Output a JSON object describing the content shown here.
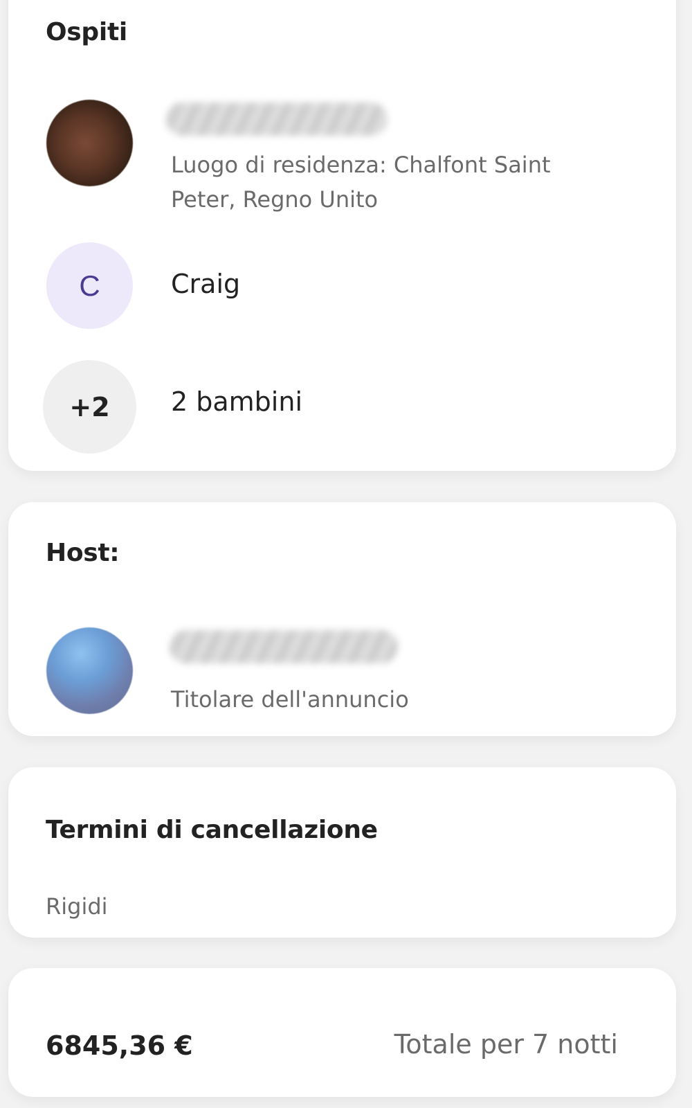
{
  "guests_section": {
    "title": "Ospiti",
    "guests": [
      {
        "avatar": "photo",
        "name_visible": false,
        "detail": "Luogo di residenza: Chalfont Saint Peter, Regno Unito"
      },
      {
        "avatar_letter": "C",
        "name": "Craig"
      },
      {
        "avatar_count": "+2",
        "name": "2 bambini"
      }
    ]
  },
  "host_section": {
    "title": "Host:",
    "host": {
      "avatar": "photo",
      "name_visible": false,
      "role": "Titolare dell'annuncio"
    }
  },
  "cancellation": {
    "title": "Termini di cancellazione",
    "value": "Rigidi"
  },
  "total": {
    "price": "6845,36 €",
    "label": "Totale per 7 notti"
  },
  "colors": {
    "background": "#f2f2f2",
    "card": "#ffffff",
    "primary_text": "#222222",
    "secondary_text": "#6a6a6a",
    "letter_avatar_bg": "#ede9fb",
    "letter_avatar_fg": "#4b3a8f",
    "count_avatar_bg": "#efefef"
  }
}
